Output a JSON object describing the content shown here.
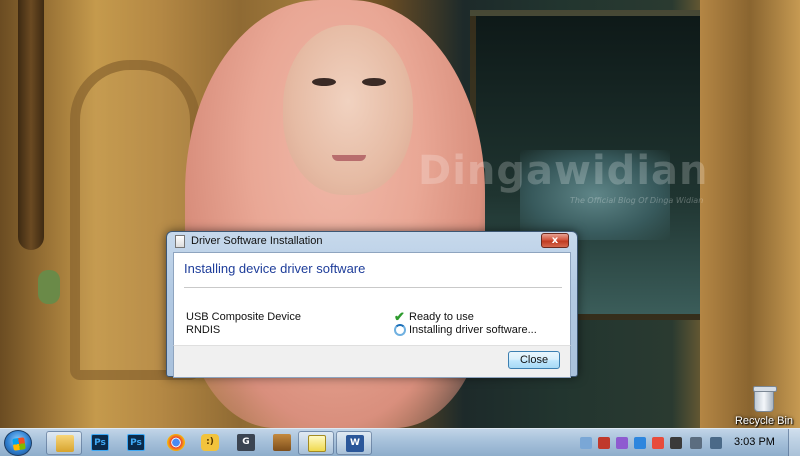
{
  "dialog": {
    "title": "Driver Software Installation",
    "heading": "Installing device driver software",
    "close_glyph": "x",
    "devices": [
      {
        "name": "USB Composite Device",
        "status": "Ready to use",
        "status_icon": "check-icon"
      },
      {
        "name": "RNDIS",
        "status": "Installing driver software...",
        "status_icon": "spinner-icon"
      }
    ],
    "close_button_label": "Close"
  },
  "desktop": {
    "watermark": "Dingawidian",
    "watermark_sub": "The Official Blog Of Dinga Widian",
    "icons": [
      {
        "label": "Recycle Bin",
        "icon": "recycle-bin-icon"
      }
    ]
  },
  "taskbar": {
    "start_icon": "windows-start-icon",
    "pinned": [
      {
        "name": "windows-explorer",
        "icon": "folder-icon",
        "glyph": ""
      },
      {
        "name": "photoshop-1",
        "icon": "photoshop-icon",
        "glyph": "Ps"
      },
      {
        "name": "photoshop-2",
        "icon": "photoshop-icon",
        "glyph": "Ps"
      },
      {
        "name": "chrome",
        "icon": "chrome-icon",
        "glyph": ""
      },
      {
        "name": "messenger",
        "icon": "messenger-icon",
        "glyph": ":)"
      },
      {
        "name": "app-g",
        "icon": "g-app-icon",
        "glyph": "G"
      },
      {
        "name": "app-box",
        "icon": "box-app-icon",
        "glyph": ""
      },
      {
        "name": "notepad",
        "icon": "notepad-icon",
        "glyph": ""
      },
      {
        "name": "word",
        "icon": "word-icon",
        "glyph": "W"
      }
    ],
    "clock": "3:03 PM"
  },
  "colors": {
    "dialog_heading": "#1e3d9a",
    "ready_check": "#2e9b2e",
    "taskbar": "#a9c3dc"
  }
}
